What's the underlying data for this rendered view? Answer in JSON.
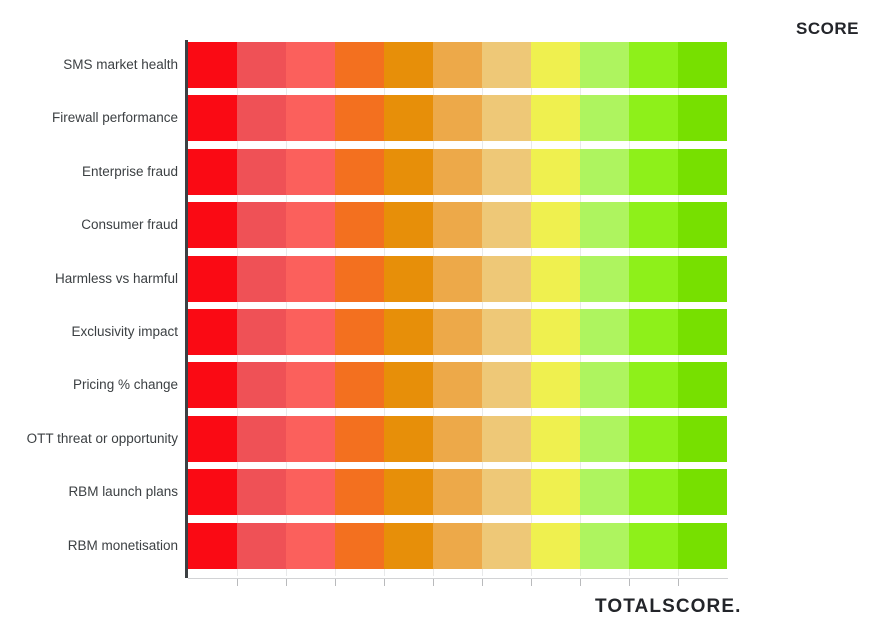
{
  "header": {
    "title": "SCORE"
  },
  "footer": {
    "brand": "TOTALSCORE."
  },
  "chart_data": {
    "type": "bar",
    "title": "SCORE",
    "subtitle": "TOTALSCORE.",
    "orientation": "horizontal",
    "xlabel": "",
    "ylabel": "",
    "grid": true,
    "legend": false,
    "xlim": [
      0,
      11
    ],
    "categories": [
      "SMS market health",
      "Firewall performance",
      "Enterprise fraud",
      "Consumer fraud",
      "Harmless vs harmful",
      "Exclusivity impact",
      "Pricing % change",
      "OTT threat or opportunity",
      "RBM launch plans",
      "RBM monetisation"
    ],
    "values": [
      11,
      11,
      11,
      11,
      11,
      11,
      11,
      11,
      11,
      11
    ],
    "tick_labels": [
      "",
      "",
      "",
      "",
      "",
      "",
      "",
      "",
      "",
      "",
      "",
      ""
    ],
    "band_count": 11,
    "band_colors": [
      "#fa0a14",
      "#ef5156",
      "#fb605c",
      "#f3701f",
      "#e78f09",
      "#eda949",
      "#eec877",
      "#eff04f",
      "#aef45f",
      "#8ef01a",
      "#77e000"
    ],
    "band_labels": [
      "band-1-critical",
      "band-2-very-poor",
      "band-3-poor",
      "band-4-below-average",
      "band-5-weak",
      "band-6-fair",
      "band-7-moderate",
      "band-8-neutral",
      "band-9-good",
      "band-10-very-good",
      "band-11-excellent"
    ],
    "axis_color": "#3c4043",
    "grid_color": "#e8e9ea",
    "text_color": "#3c4043",
    "brand_text_color": "#23252a"
  }
}
